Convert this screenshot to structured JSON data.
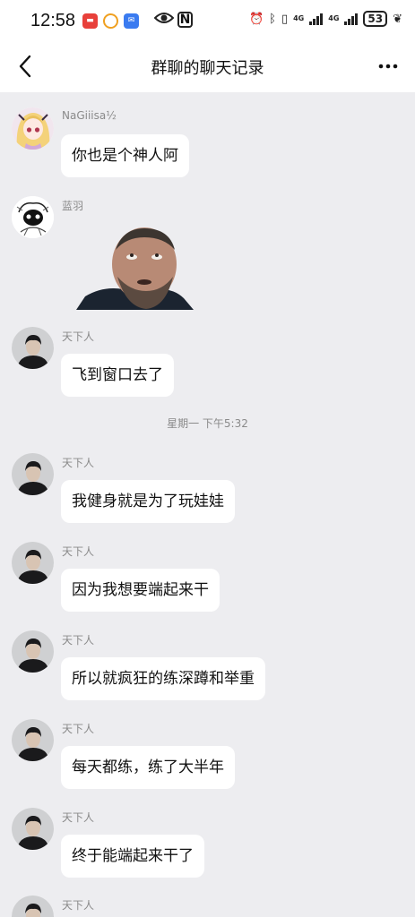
{
  "status_bar": {
    "time": "12:58",
    "battery": "53",
    "network_1": "4G",
    "network_2": "4G"
  },
  "nav": {
    "title": "群聊的聊天记录",
    "back_icon": "chevron-left-icon",
    "more_icon": "more-horizontal-icon"
  },
  "messages": [
    {
      "sender": "NaGiiisa½",
      "text": "你也是个神人阿",
      "avatar": "anime-girl-avatar"
    },
    {
      "sender": "蓝羽",
      "sticker": "bearded-man-looking-up-sticker",
      "avatar": "sketch-character-avatar"
    },
    {
      "sender": "天下人",
      "text": "飞到窗口去了",
      "avatar": "dark-portrait-avatar"
    },
    {
      "sender": "天下人",
      "text": "我健身就是为了玩娃娃",
      "avatar": "dark-portrait-avatar"
    },
    {
      "sender": "天下人",
      "text": "因为我想要端起来干",
      "avatar": "dark-portrait-avatar"
    },
    {
      "sender": "天下人",
      "text": "所以就疯狂的练深蹲和举重",
      "avatar": "dark-portrait-avatar"
    },
    {
      "sender": "天下人",
      "text": "每天都练，练了大半年",
      "avatar": "dark-portrait-avatar"
    },
    {
      "sender": "天下人",
      "text": "终于能端起来干了",
      "avatar": "dark-portrait-avatar"
    },
    {
      "sender": "天下人",
      "avatar": "dark-portrait-avatar"
    }
  ],
  "timestamp": "星期一 下午5:32",
  "colors": {
    "background": "#ededf0",
    "bubble": "#ffffff",
    "meta_text": "#8a8a8a"
  }
}
